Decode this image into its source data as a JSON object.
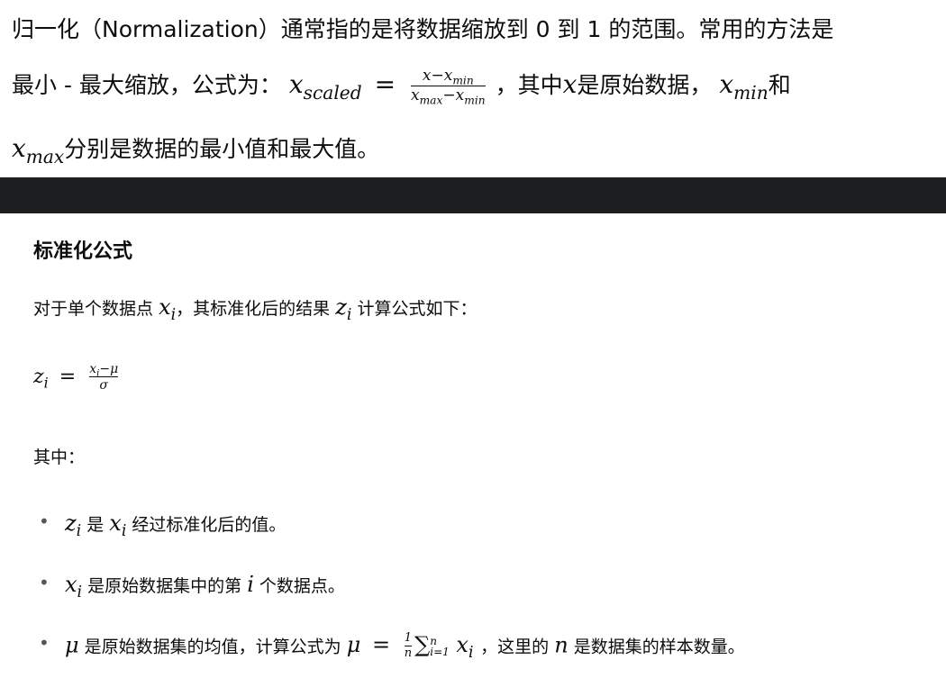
{
  "intro": {
    "l1": "归一化（Normalization）通常指的是将数据缩放到 0 到 1 的范围。常用的方法是",
    "l2_prefix": "最小 - 最大缩放，公式为：",
    "x": "x",
    "scaled": "scaled",
    "eq": "=",
    "minus": "−",
    "min": "min",
    "max": "max",
    "l2_mid": "，其中",
    "l2_mid2": "是原始数据，",
    "and": "和",
    "l3_suffix": "分别是数据的最小值和最大值。"
  },
  "doc": {
    "heading": "标准化公式",
    "p1_a": "对于单个数据点",
    "p1_b": "，其标准化后的结果",
    "p1_c": "计算公式如下：",
    "z": "z",
    "i": "i",
    "mu": "μ",
    "sigma": "σ",
    "n": "n",
    "one": "1",
    "sum": "∑",
    "i_eq_1": "i=1",
    "where": "其中：",
    "b1_a": "是",
    "b1_b": "经过标准化后的值。",
    "b2_a": "是原始数据集中的第",
    "b2_b": "个数据点。",
    "b3_a": "是原始数据集的均值，计算公式为",
    "b3_b": "，这里的",
    "b3_c": "是数据集的样本数量。"
  }
}
